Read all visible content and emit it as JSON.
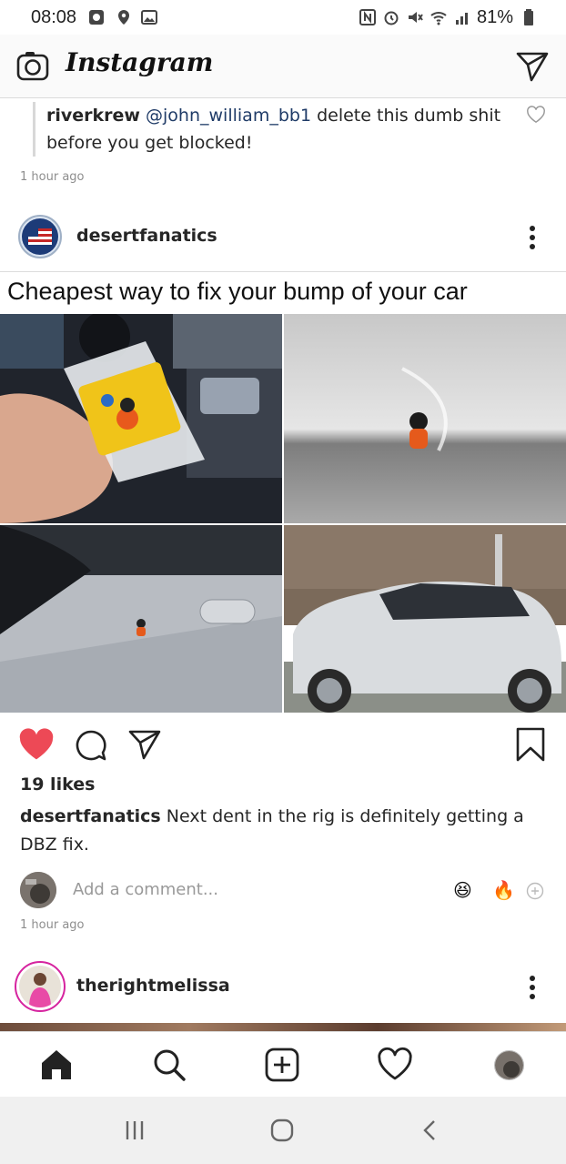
{
  "status_bar": {
    "time": "08:08",
    "battery": "81%",
    "icons": [
      "notification-box-icon",
      "location-icon",
      "image-icon",
      "nfc-icon",
      "alarm-icon",
      "mute-icon",
      "wifi-icon",
      "signal-icon",
      "battery-icon"
    ]
  },
  "header": {
    "app_name": "Instagram",
    "camera_icon": "camera-icon",
    "direct_icon": "paper-plane-icon"
  },
  "previous_comment": {
    "user": "riverkrew",
    "mention": "@john_william_bb1",
    "text": "delete this dumb shit before you get blocked!",
    "time": "1 hour ago"
  },
  "post": {
    "username": "desertfanatics",
    "image_caption": "Cheapest way to fix your bump of your car",
    "likes": "19 likes",
    "caption_user": "desertfanatics",
    "caption_text": "Next dent in the rig is definitely getting a DBZ fix.",
    "comment_placeholder": "Add a comment...",
    "time": "1 hour ago",
    "quick_reactions": [
      "😆",
      "🔥"
    ],
    "like_color": "#ed4956"
  },
  "next_post": {
    "username": "therightmelissa"
  },
  "bottom_nav": {
    "items": [
      "home-icon",
      "search-icon",
      "add-icon",
      "heart-icon",
      "profile-icon"
    ]
  },
  "android_nav": {
    "items": [
      "recent-apps-icon",
      "home-button-icon",
      "back-icon"
    ]
  }
}
